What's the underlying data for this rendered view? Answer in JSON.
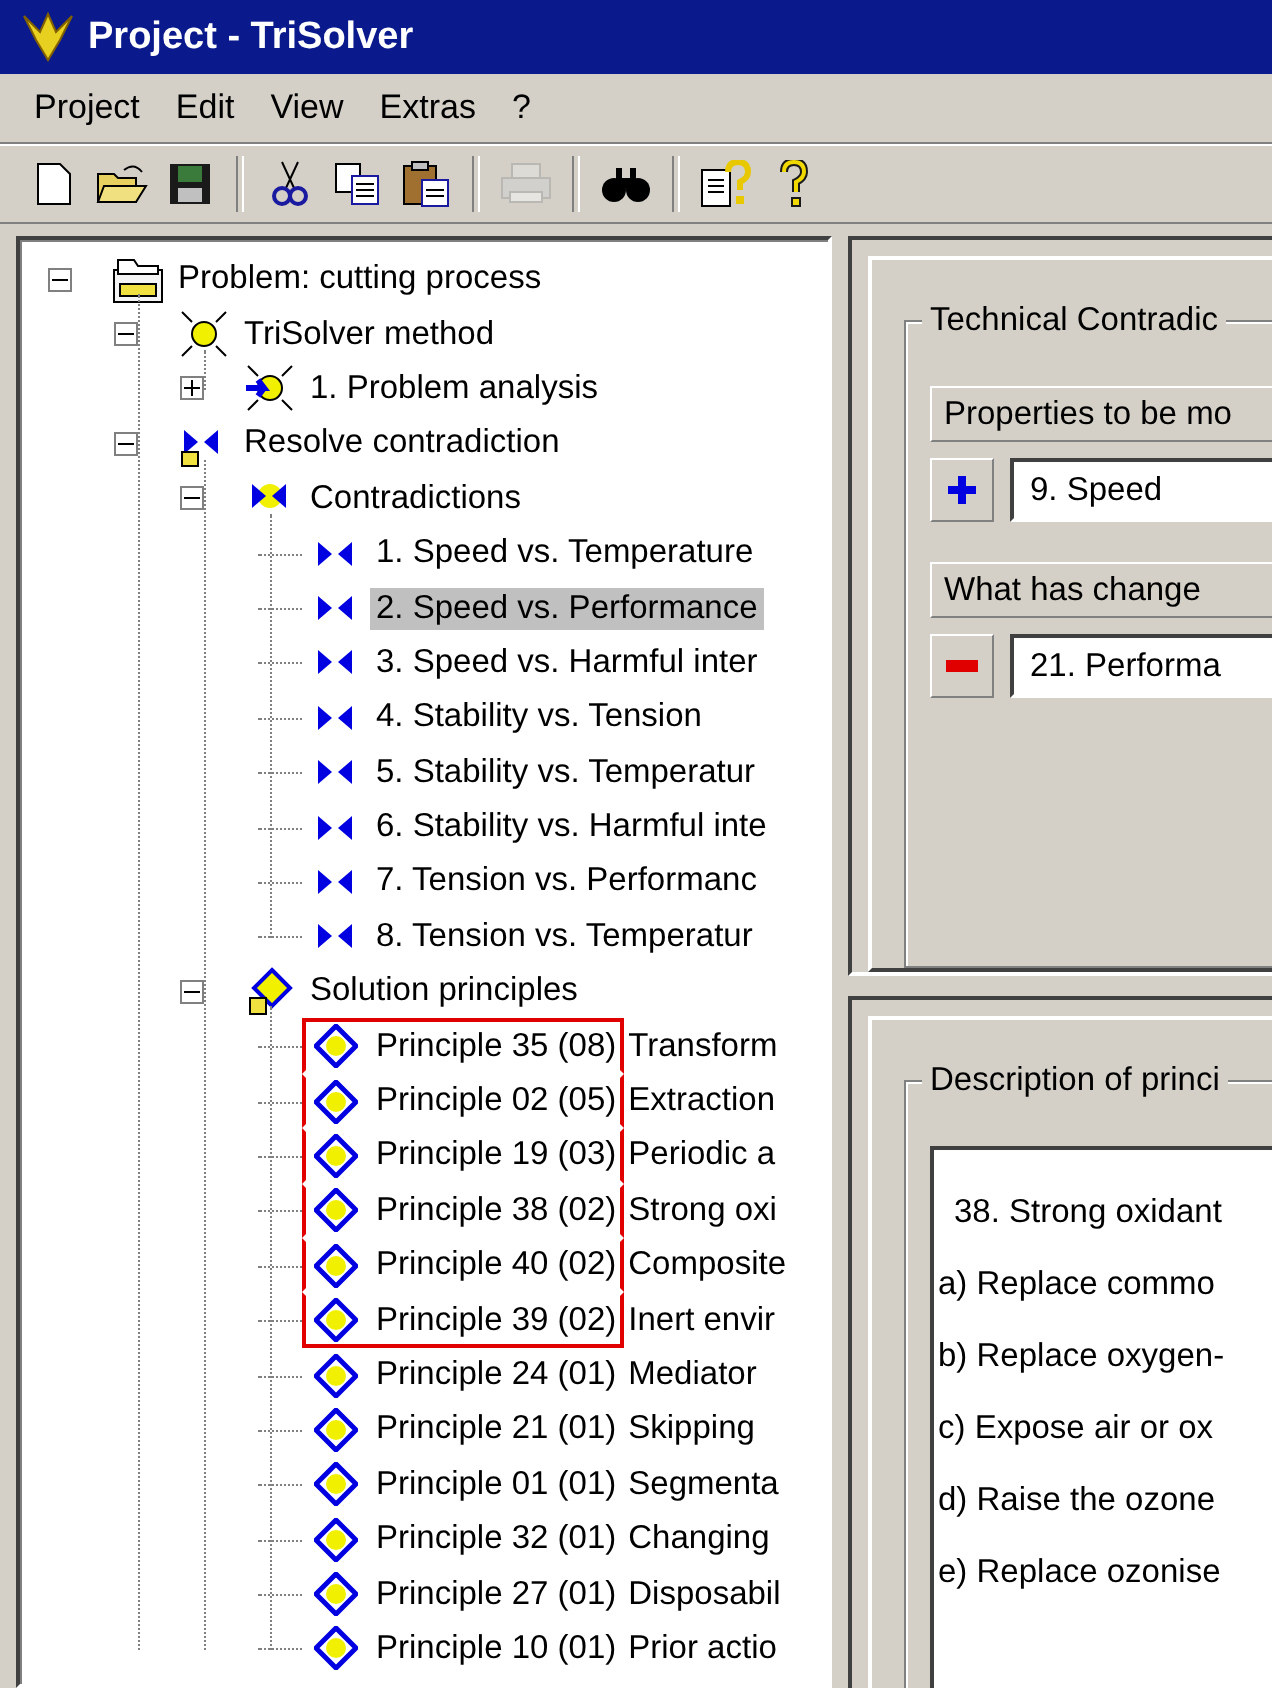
{
  "window": {
    "title": "Project - TriSolver"
  },
  "menu": [
    "Project",
    "Edit",
    "View",
    "Extras",
    "?"
  ],
  "toolbar": [
    {
      "kind": "new",
      "disabled": false
    },
    {
      "kind": "open",
      "disabled": false
    },
    {
      "kind": "save",
      "disabled": false
    },
    {
      "kind": "separator"
    },
    {
      "kind": "cut",
      "disabled": false
    },
    {
      "kind": "copy",
      "disabled": false
    },
    {
      "kind": "paste",
      "disabled": false
    },
    {
      "kind": "separator"
    },
    {
      "kind": "print",
      "disabled": true
    },
    {
      "kind": "separator"
    },
    {
      "kind": "find",
      "disabled": false
    },
    {
      "kind": "separator"
    },
    {
      "kind": "context-help",
      "disabled": false
    },
    {
      "kind": "help",
      "disabled": false
    }
  ],
  "tree": [
    {
      "label": "Problem: cutting process",
      "kind": "project",
      "expanded": true,
      "selected": false,
      "children": [
        {
          "label": "TriSolver method",
          "kind": "method",
          "expanded": true,
          "selected": false,
          "children": [
            {
              "label": "1. Problem analysis",
              "kind": "method-step",
              "expanded": false,
              "selected": false
            }
          ]
        },
        {
          "label": "Resolve contradiction",
          "kind": "resolve",
          "expanded": true,
          "selected": false,
          "children": [
            {
              "label": "Contradictions",
              "kind": "contradiction-group",
              "expanded": true,
              "selected": false,
              "children": [
                {
                  "label": "1. Speed vs. Temperature",
                  "kind": "contradiction",
                  "selected": false
                },
                {
                  "label": "2. Speed vs. Performance",
                  "kind": "contradiction",
                  "selected": true
                },
                {
                  "label": "3. Speed vs. Harmful inter",
                  "kind": "contradiction",
                  "selected": false
                },
                {
                  "label": "4. Stability vs. Tension",
                  "kind": "contradiction",
                  "selected": false
                },
                {
                  "label": "5. Stability vs. Temperatur",
                  "kind": "contradiction",
                  "selected": false
                },
                {
                  "label": "6. Stability vs. Harmful inte",
                  "kind": "contradiction",
                  "selected": false
                },
                {
                  "label": "7. Tension vs. Performanc",
                  "kind": "contradiction",
                  "selected": false
                },
                {
                  "label": "8. Tension vs. Temperatur",
                  "kind": "contradiction",
                  "selected": false
                }
              ]
            },
            {
              "label": "Solution principles",
              "kind": "principle-group",
              "expanded": true,
              "selected": false,
              "children": [
                {
                  "number": "Principle 35 (08)",
                  "label": "Transform",
                  "kind": "principle",
                  "selected": false,
                  "marked": true
                },
                {
                  "number": "Principle 02 (05)",
                  "label": "Extraction",
                  "kind": "principle",
                  "selected": false,
                  "marked": true
                },
                {
                  "number": "Principle 19 (03)",
                  "label": "Periodic a",
                  "kind": "principle",
                  "selected": false,
                  "marked": true
                },
                {
                  "number": "Principle 38 (02)",
                  "label": "Strong oxi",
                  "kind": "principle",
                  "selected": false,
                  "marked": true
                },
                {
                  "number": "Principle 40 (02)",
                  "label": "Composite",
                  "kind": "principle",
                  "selected": false,
                  "marked": true
                },
                {
                  "number": "Principle 39 (02)",
                  "label": "Inert envir",
                  "kind": "principle",
                  "selected": false,
                  "marked": true
                },
                {
                  "number": "Principle 24 (01)",
                  "label": "Mediator",
                  "kind": "principle",
                  "selected": false,
                  "marked": false
                },
                {
                  "number": "Principle 21 (01)",
                  "label": "Skipping",
                  "kind": "principle",
                  "selected": false,
                  "marked": false
                },
                {
                  "number": "Principle 01 (01)",
                  "label": "Segmenta",
                  "kind": "principle",
                  "selected": false,
                  "marked": false
                },
                {
                  "number": "Principle 32 (01)",
                  "label": "Changing",
                  "kind": "principle",
                  "selected": false,
                  "marked": false
                },
                {
                  "number": "Principle 27 (01)",
                  "label": "Disposabil",
                  "kind": "principle",
                  "selected": false,
                  "marked": false
                },
                {
                  "number": "Principle 10 (01)",
                  "label": "Prior actio",
                  "kind": "principle",
                  "selected": false,
                  "marked": false
                }
              ]
            }
          ]
        }
      ]
    }
  ],
  "contradiction_panel": {
    "title": "Technical Contradic",
    "rows": [
      {
        "label": "Properties to be mo",
        "kind": "plus",
        "value": "9. Speed"
      },
      {
        "label": "What has change",
        "kind": "minus",
        "value": "21. Performa"
      }
    ]
  },
  "description_panel": {
    "title": "Description of princi",
    "lines": [
      "38. Strong oxidant",
      "a) Replace commo",
      "b) Replace oxygen-",
      "c) Expose air or ox",
      "d) Raise the ozone",
      "e) Replace ozonise"
    ]
  }
}
